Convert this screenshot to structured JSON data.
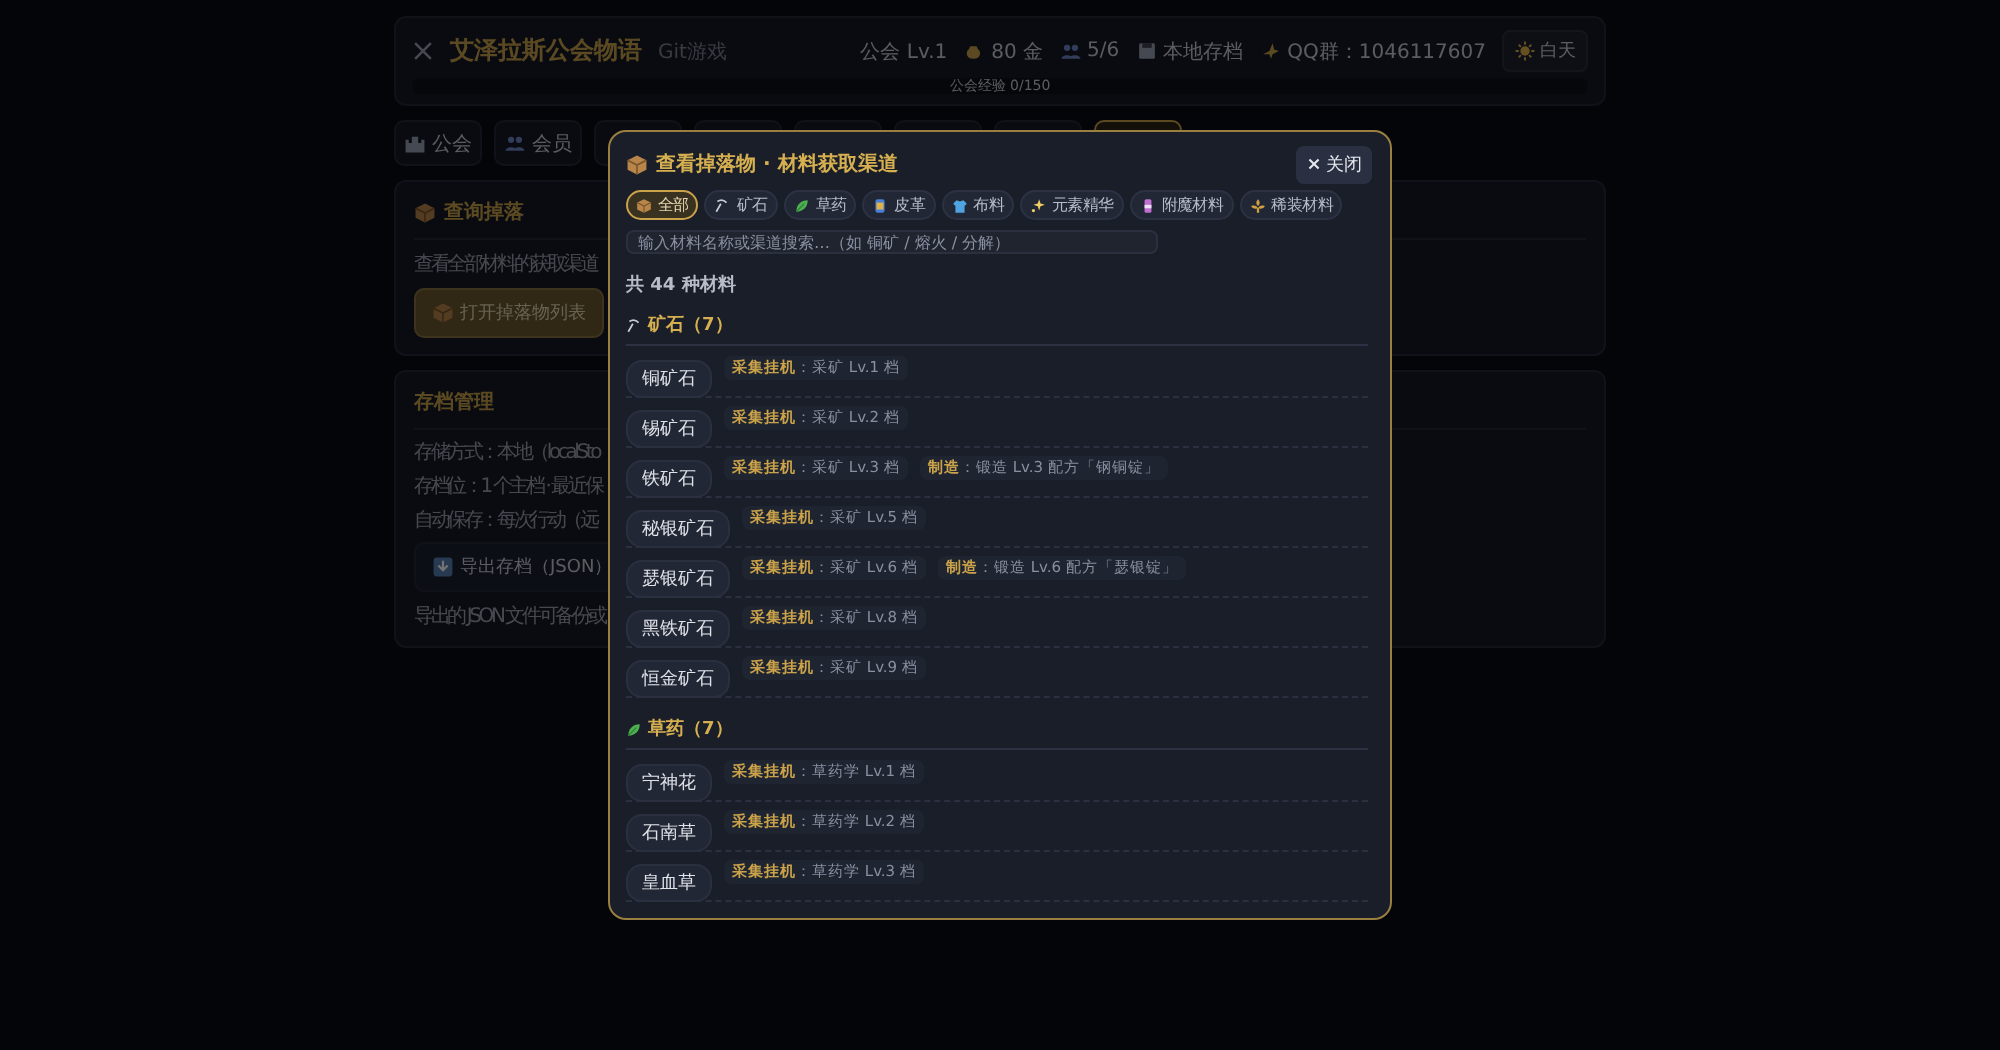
{
  "header": {
    "title": "艾泽拉斯公会物语",
    "subtitle": "Git游戏",
    "stats": [
      {
        "kind": "level",
        "text": "公会 Lv.1"
      },
      {
        "kind": "gold",
        "text": "80 金"
      },
      {
        "kind": "members",
        "text": "5/6"
      },
      {
        "kind": "save",
        "text": "本地存档"
      },
      {
        "kind": "qq",
        "text": "QQ群：1046117607"
      }
    ],
    "theme_button": "白天",
    "progress": {
      "label": "公会经验 0/150",
      "level": 0
    }
  },
  "tabs": [
    {
      "kind": "castle",
      "label": "公会",
      "selected": false
    },
    {
      "kind": "people",
      "label": "会员",
      "selected": false
    },
    {
      "kind": "blank",
      "selected": false
    },
    {
      "kind": "blank",
      "selected": false
    },
    {
      "kind": "blank",
      "selected": false
    },
    {
      "kind": "blank",
      "selected": false
    },
    {
      "kind": "blank",
      "selected": false
    },
    {
      "kind": "blank",
      "selected": true
    }
  ],
  "drop_panel": {
    "title": "查询掉落",
    "text": "查看全部材料的获取渠道（",
    "button": "打开掉落物列表"
  },
  "save_panel": {
    "title": "存档管理",
    "lines": [
      "存储方式：本地（localSto",
      "存档位：1 个主档 · 最近保",
      "自动保存：每次行动（远"
    ],
    "button": "导出存档（JSON）",
    "note": "导出的 JSON 文件可备份或"
  },
  "modal": {
    "title": "查看掉落物 · 材料获取渠道",
    "close": "关闭",
    "filters": [
      {
        "kind": "box",
        "label": "全部",
        "selected": true
      },
      {
        "kind": "pick",
        "label": "矿石",
        "selected": false
      },
      {
        "kind": "leaf",
        "label": "草药",
        "selected": false
      },
      {
        "kind": "hide",
        "label": "皮革",
        "selected": false
      },
      {
        "kind": "shirt",
        "label": "布料",
        "selected": false
      },
      {
        "kind": "spark",
        "label": "元素精华",
        "selected": false
      },
      {
        "kind": "potion",
        "label": "附魔材料",
        "selected": false
      },
      {
        "kind": "fleur",
        "label": "稀装材料",
        "selected": false
      }
    ],
    "search": {
      "placeholder": "输入材料名称或渠道搜索…（如 铜矿 / 熔火 / 分解）"
    },
    "count": "共 44 种材料",
    "groups": [
      {
        "kind": "pick",
        "title": "矿石（7）",
        "items": [
          {
            "name": "铜矿石",
            "sources": [
              "**采集挂机**：采矿 Lv.1 档"
            ]
          },
          {
            "name": "锡矿石",
            "sources": [
              "**采集挂机**：采矿 Lv.2 档"
            ]
          },
          {
            "name": "铁矿石",
            "sources": [
              "**采集挂机**：采矿 Lv.3 档",
              "**制造**：锻造 Lv.3 配方「钢铜锭」"
            ]
          },
          {
            "name": "秘银矿石",
            "sources": [
              "**采集挂机**：采矿 Lv.5 档"
            ]
          },
          {
            "name": "瑟银矿石",
            "sources": [
              "**采集挂机**：采矿 Lv.6 档",
              "**制造**：锻造 Lv.6 配方「瑟银锭」"
            ]
          },
          {
            "name": "黑铁矿石",
            "sources": [
              "**采集挂机**：采矿 Lv.8 档"
            ]
          },
          {
            "name": "恒金矿石",
            "sources": [
              "**采集挂机**：采矿 Lv.9 档"
            ]
          }
        ]
      },
      {
        "kind": "leaf",
        "title": "草药（7）",
        "items": [
          {
            "name": "宁神花",
            "sources": [
              "**采集挂机**：草药学 Lv.1 档"
            ]
          },
          {
            "name": "石南草",
            "sources": [
              "**采集挂机**：草药学 Lv.2 档"
            ]
          },
          {
            "name": "皇血草",
            "sources": [
              "**采集挂机**：草药学 Lv.3 档"
            ]
          }
        ]
      }
    ]
  }
}
